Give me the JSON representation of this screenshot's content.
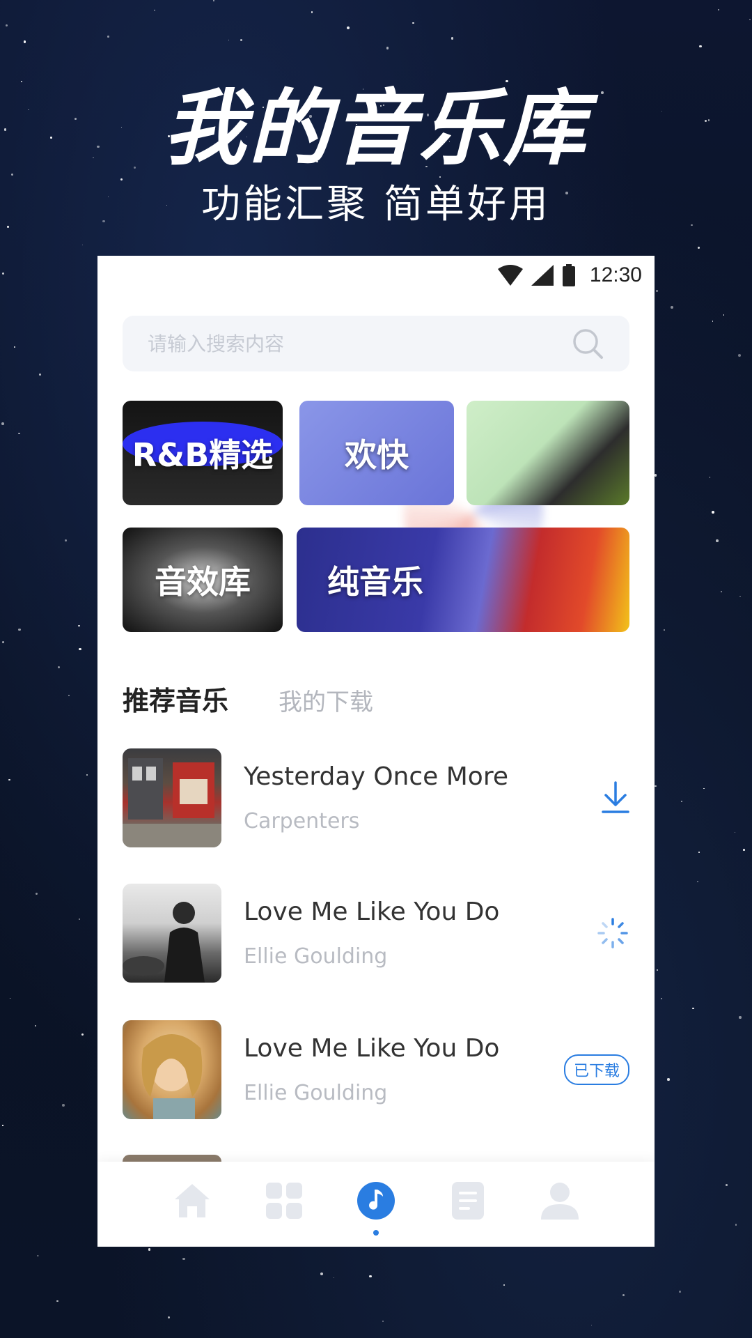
{
  "hero": {
    "title": "我的音乐库",
    "subtitle": "功能汇聚 简单好用"
  },
  "status_bar": {
    "time": "12:30",
    "icons": [
      "wifi-icon",
      "signal-icon",
      "battery-icon"
    ]
  },
  "search": {
    "placeholder": "请输入搜索内容",
    "value": ""
  },
  "categories": [
    {
      "label": "R&B精选"
    },
    {
      "label": "欢快"
    },
    {
      "label": "音效库"
    },
    {
      "label": "纯音乐"
    }
  ],
  "tabs": [
    {
      "label": "推荐音乐",
      "active": true
    },
    {
      "label": "我的下载",
      "active": false
    }
  ],
  "songs": [
    {
      "title": "Yesterday Once More",
      "artist": "Carpenters",
      "action": "download-icon"
    },
    {
      "title": "Love Me Like You Do",
      "artist": "Ellie  Goulding",
      "action": "loading-spinner-icon"
    },
    {
      "title": "Love Me Like You Do",
      "artist": "Ellie  Goulding",
      "action": "downloaded-badge",
      "badge": "已下载"
    }
  ],
  "bottom_nav": [
    {
      "icon": "home-icon",
      "active": false
    },
    {
      "icon": "grid-icon",
      "active": false
    },
    {
      "icon": "music-note-icon",
      "active": true
    },
    {
      "icon": "document-icon",
      "active": false
    },
    {
      "icon": "user-icon",
      "active": false
    }
  ],
  "colors": {
    "accent": "#2a7de1",
    "inactive_icon": "#e4e7ed",
    "background": "#0b1226"
  }
}
